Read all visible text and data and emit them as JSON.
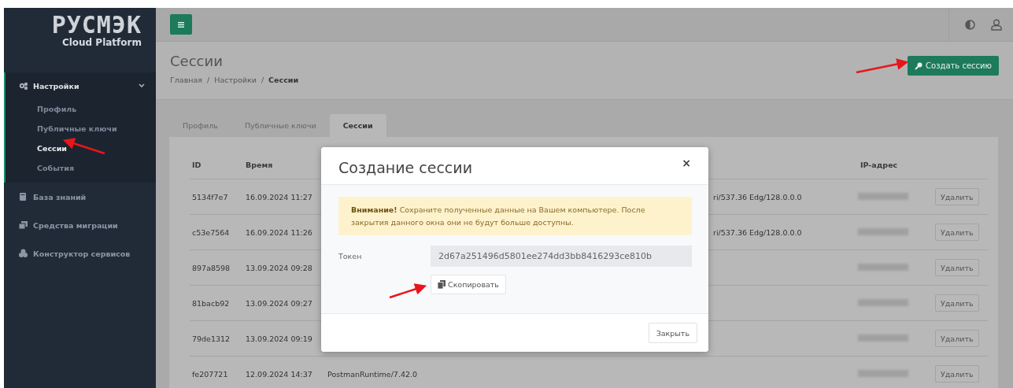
{
  "logo": {
    "wordmark": "РУСМЭК",
    "subtitle": "Cloud Platform"
  },
  "sidebar": {
    "items": [
      {
        "label": "Настройки",
        "expanded": true,
        "children": [
          {
            "label": "Профиль",
            "selected": false
          },
          {
            "label": "Публичные ключи",
            "selected": false
          },
          {
            "label": "Сессии",
            "selected": true
          },
          {
            "label": "События",
            "selected": false
          }
        ]
      },
      {
        "label": "База знаний"
      },
      {
        "label": "Средства миграции"
      },
      {
        "label": "Конструктор сервисов"
      }
    ]
  },
  "header": {
    "title": "Сессии",
    "breadcrumbs": [
      "Главная",
      "Настройки",
      "Сессии"
    ],
    "separator": "/",
    "create_button": "Создать сессию"
  },
  "tabs": [
    {
      "label": "Профиль",
      "selected": false
    },
    {
      "label": "Публичные ключи",
      "selected": false
    },
    {
      "label": "Сессии",
      "selected": true
    }
  ],
  "table": {
    "columns": [
      "ID",
      "Время",
      "IP-адрес"
    ],
    "rows": [
      {
        "id": "5134f7e7",
        "time": "16.09.2024 11:27",
        "column_3": "ri/537.36 Edg/128.0.0.0",
        "partly_hidden": true,
        "action": "Удалить"
      },
      {
        "id": "c53e7564",
        "time": "16.09.2024 11:26",
        "column_3": "ri/537.36 Edg/128.0.0.0",
        "partly_hidden": true,
        "action": "Удалить"
      },
      {
        "id": "897a8598",
        "time": "13.09.2024 09:28",
        "action": "Удалить"
      },
      {
        "id": "81bacb92",
        "time": "13.09.2024 09:27",
        "action": "Удалить"
      },
      {
        "id": "79de1312",
        "time": "13.09.2024 09:19",
        "action": "Удалить"
      },
      {
        "id": "fe207721",
        "time": "12.09.2024 14:37",
        "column_3": "PostmanRuntime/7.42.0",
        "partly_hidden": false,
        "action": "Удалить"
      }
    ]
  },
  "modal": {
    "title": "Создание сессии",
    "close": "×",
    "alert": "**Внимание!** Сохраните полученные данные на Вашем компьютере. После закрытия данного окна они не будут больше доступны.",
    "token_label": "Токен",
    "token_value": "2d67a251496d5801ee274dd3bb8416293ce810b",
    "copy_button": "Скопировать",
    "close_button": "Закрыть"
  }
}
